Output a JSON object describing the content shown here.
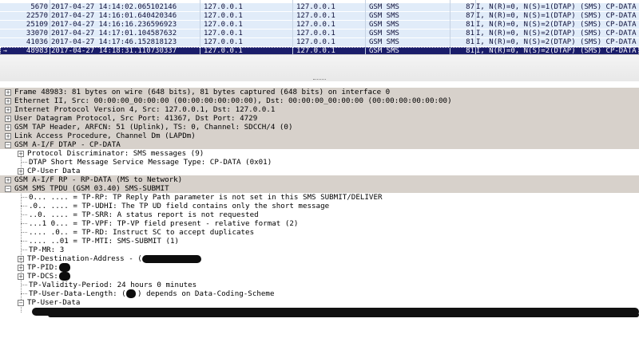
{
  "packet_list": {
    "rows": [
      {
        "no": "5670",
        "time": "2017-04-27 14:14:02.065102146",
        "src": "127.0.0.1",
        "dst": "127.0.0.1",
        "proto": "GSM SMS",
        "len": "87",
        "info": "I, N(R)=0, N(S)=1(DTAP) (SMS) CP-DATA",
        "selected": false
      },
      {
        "no": "22570",
        "time": "2017-04-27 14:16:01.640420346",
        "src": "127.0.0.1",
        "dst": "127.0.0.1",
        "proto": "GSM SMS",
        "len": "87",
        "info": "I, N(R)=0, N(S)=1(DTAP) (SMS) CP-DATA",
        "selected": false
      },
      {
        "no": "25109",
        "time": "2017-04-27 14:16:16.236596923",
        "src": "127.0.0.1",
        "dst": "127.0.0.1",
        "proto": "GSM SMS",
        "len": "81",
        "info": "I, N(R)=0, N(S)=2(DTAP) (SMS) CP-DATA",
        "selected": false
      },
      {
        "no": "33070",
        "time": "2017-04-27 14:17:01.104587632",
        "src": "127.0.0.1",
        "dst": "127.0.0.1",
        "proto": "GSM SMS",
        "len": "81",
        "info": "I, N(R)=0, N(S)=2(DTAP) (SMS) CP-DATA",
        "selected": false
      },
      {
        "no": "41036",
        "time": "2017-04-27 14:17:46.152818123",
        "src": "127.0.0.1",
        "dst": "127.0.0.1",
        "proto": "GSM SMS",
        "len": "81",
        "info": "I, N(R)=0, N(S)=2(DTAP) (SMS) CP-DATA",
        "selected": false
      },
      {
        "no": "48983",
        "time": "2017-04-27 14:18:31.110730337",
        "src": "127.0.0.1",
        "dst": "127.0.0.1",
        "proto": "GSM SMS",
        "len": "81",
        "info": "I, N(R)=0, N(S)=2(DTAP) (SMS) CP-DATA",
        "selected": true
      }
    ]
  },
  "details": {
    "frame": "Frame 48983: 81 bytes on wire (648 bits), 81 bytes captured (648 bits) on interface 0",
    "ethernet": "Ethernet II, Src: 00:00:00_00:00:00 (00:00:00:00:00:00), Dst: 00:00:00_00:00:00 (00:00:00:00:00:00)",
    "ip": "Internet Protocol Version 4, Src: 127.0.0.1, Dst: 127.0.0.1",
    "udp": "User Datagram Protocol, Src Port: 41367, Dst Port: 4729",
    "gsmtap": "GSM TAP Header, ARFCN: 51 (Uplink), TS: 0, Channel: SDCCH/4 (0)",
    "lapdm": "Link Access Procedure, Channel Dm (LAPDm)",
    "dtap": "GSM A-I/F DTAP - CP-DATA",
    "dtap_pd": "Protocol Discriminator: SMS messages (9)",
    "dtap_mt": "DTAP Short Message Service Message Type: CP-DATA (0x01)",
    "dtap_ud": "CP-User Data",
    "rp": "GSM A-I/F RP - RP-DATA (MS to Network)",
    "tpdu": "GSM SMS TPDU (GSM 03.40) SMS-SUBMIT",
    "tp_rp": "0... .... = TP-RP: TP Reply Path parameter is not set in this SMS SUBMIT/DELIVER",
    "tp_udhi": ".0.. .... = TP-UDHI: The TP UD field contains only the short message",
    "tp_srr": "..0. .... = TP-SRR: A status report is not requested",
    "tp_vpf": "...1 0... = TP-VPF: TP-VP field present - relative format (2)",
    "tp_rd": ".... .0.. = TP-RD: Instruct SC to accept duplicates",
    "tp_mti": ".... ..01 = TP-MTI: SMS-SUBMIT (1)",
    "tp_mr": "TP-MR: 3",
    "tp_da": "TP-Destination-Address - (",
    "tp_pid": "TP-PID:",
    "tp_dcs": "TP-DCS:",
    "tp_vp": "TP-Validity-Period: 24 hours 0 minutes",
    "tp_udl_a": "TP-User-Data-Length: (",
    "tp_udl_b": ") depends on Data-Coding-Scheme",
    "tp_ud": "TP-User-Data"
  },
  "colors": {
    "row_bg": "#e1ecf9",
    "row_text": "#10113a",
    "selected_bg": "#1a1d6a",
    "header_bg": "#d7d1cb",
    "redaction": "#0d0d0d"
  },
  "icons": {
    "expand": "plus-box-icon",
    "collapse": "minus-box-icon",
    "selected_marker": "arrow-icon"
  }
}
